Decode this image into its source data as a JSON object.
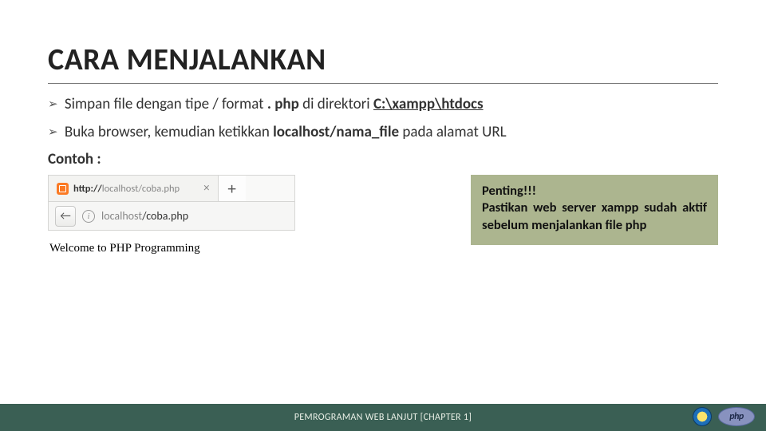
{
  "title": "CARA MENJALANKAN",
  "bullet1": {
    "pre": "Simpan file dengan tipe / format",
    "bold1": ". php",
    "mid": " di direktori ",
    "bold2": "C:\\xampp\\htdocs"
  },
  "bullet2": {
    "pre": "Buka browser, kemudian ketikkan ",
    "bold": "localhost/nama_file",
    "post": " pada alamat URL"
  },
  "contoh": "Contoh :",
  "browser": {
    "tab_url_dark": "http://",
    "tab_url_rest": "localhost/coba.php",
    "addr_host": "localhost",
    "addr_path": "/coba.php",
    "page_text": "Welcome to PHP Programming"
  },
  "note": {
    "l1": "Penting!!!",
    "l2": "Pastikan web server xampp sudah aktif sebelum menjalankan file php"
  },
  "footer": "PEMROGRAMAN WEB LANJUT [CHAPTER 1]",
  "php_label": "php"
}
